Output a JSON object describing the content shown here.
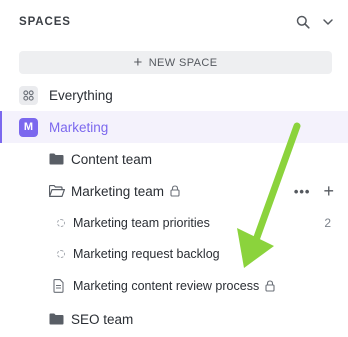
{
  "header": {
    "title": "SPACES",
    "search_icon": "search-icon",
    "collapse_icon": "chevron-down-icon"
  },
  "new_space": {
    "label": "NEW SPACE",
    "icon": "plus-icon"
  },
  "spaces": [
    {
      "label": "Everything",
      "icon": "grid-icon"
    },
    {
      "label": "Marketing",
      "avatar": "M",
      "active": true,
      "accent": "#7b68ee"
    }
  ],
  "tree": {
    "content_team": {
      "label": "Content team",
      "icon": "folder-icon"
    },
    "marketing_team": {
      "label": "Marketing team",
      "icon": "folder-open-icon",
      "private": true,
      "more_label": "•••",
      "add_label": "+"
    },
    "lists": [
      {
        "label": "Marketing team priorities",
        "count": "2"
      },
      {
        "label": "Marketing request backlog"
      }
    ],
    "doc": {
      "label": "Marketing content review process",
      "icon": "document-icon",
      "private": true
    },
    "seo_team": {
      "label": "SEO team",
      "icon": "folder-icon"
    }
  },
  "annotation": {
    "arrow_color": "#8bd33c"
  }
}
